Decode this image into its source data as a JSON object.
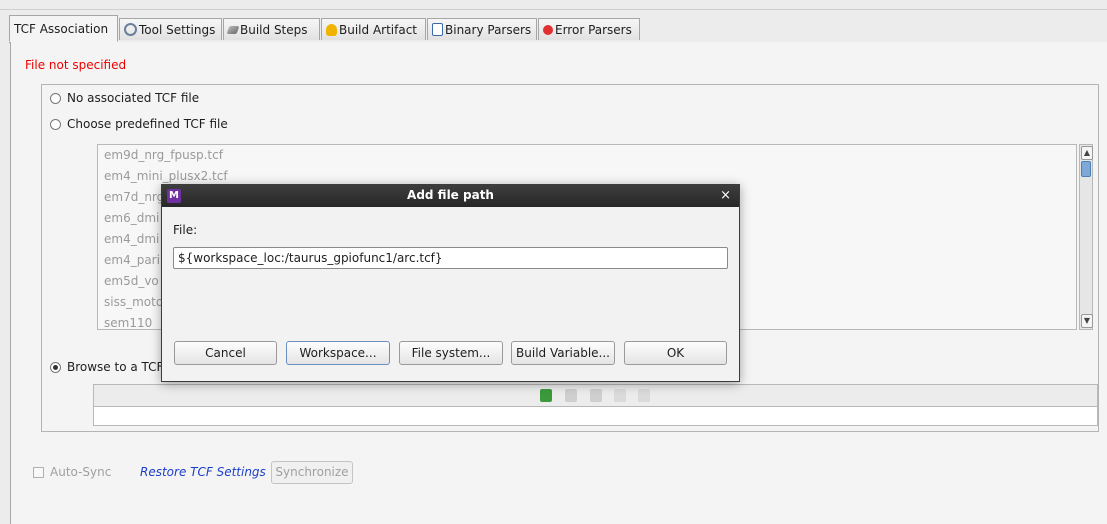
{
  "tabs": [
    {
      "label": "TCF Association",
      "icon": "",
      "active": true
    },
    {
      "label": "Tool Settings",
      "icon": "tool-settings-icon"
    },
    {
      "label": "Build Steps",
      "icon": "build-steps-icon"
    },
    {
      "label": "Build Artifact",
      "icon": "build-artifact-icon"
    },
    {
      "label": "Binary Parsers",
      "icon": "binary-parsers-icon"
    },
    {
      "label": "Error Parsers",
      "icon": "error-parsers-icon"
    }
  ],
  "error_message": "File not specified",
  "options": {
    "no_tcf": "No associated TCF file",
    "predefined": "Choose predefined TCF file",
    "browse": "Browse to a TCF"
  },
  "tcf_list": [
    "em9d_nrg_fpusp.tcf",
    "em4_mini_plusx2.tcf",
    "em7d_nrg",
    "em6_dmi",
    "em4_dmi",
    "em4_pari",
    "em5d_vo",
    "siss_moto",
    "sem110_"
  ],
  "bottom": {
    "auto_sync": "Auto-Sync",
    "restore": "Restore TCF Settings",
    "synchronize": "Synchronize"
  },
  "dialog": {
    "app_icon": "M",
    "title": "Add file path",
    "close": "×",
    "file_label": "File:",
    "file_value": "${workspace_loc:/taurus_gpiofunc1/arc.tcf}",
    "buttons": {
      "cancel": "Cancel",
      "workspace": "Workspace...",
      "file_system": "File system...",
      "build_variable": "Build Variable...",
      "ok": "OK"
    }
  },
  "colors": {
    "error": "#ee0000",
    "link": "#1b3fc8",
    "accent": "#7030a0"
  }
}
